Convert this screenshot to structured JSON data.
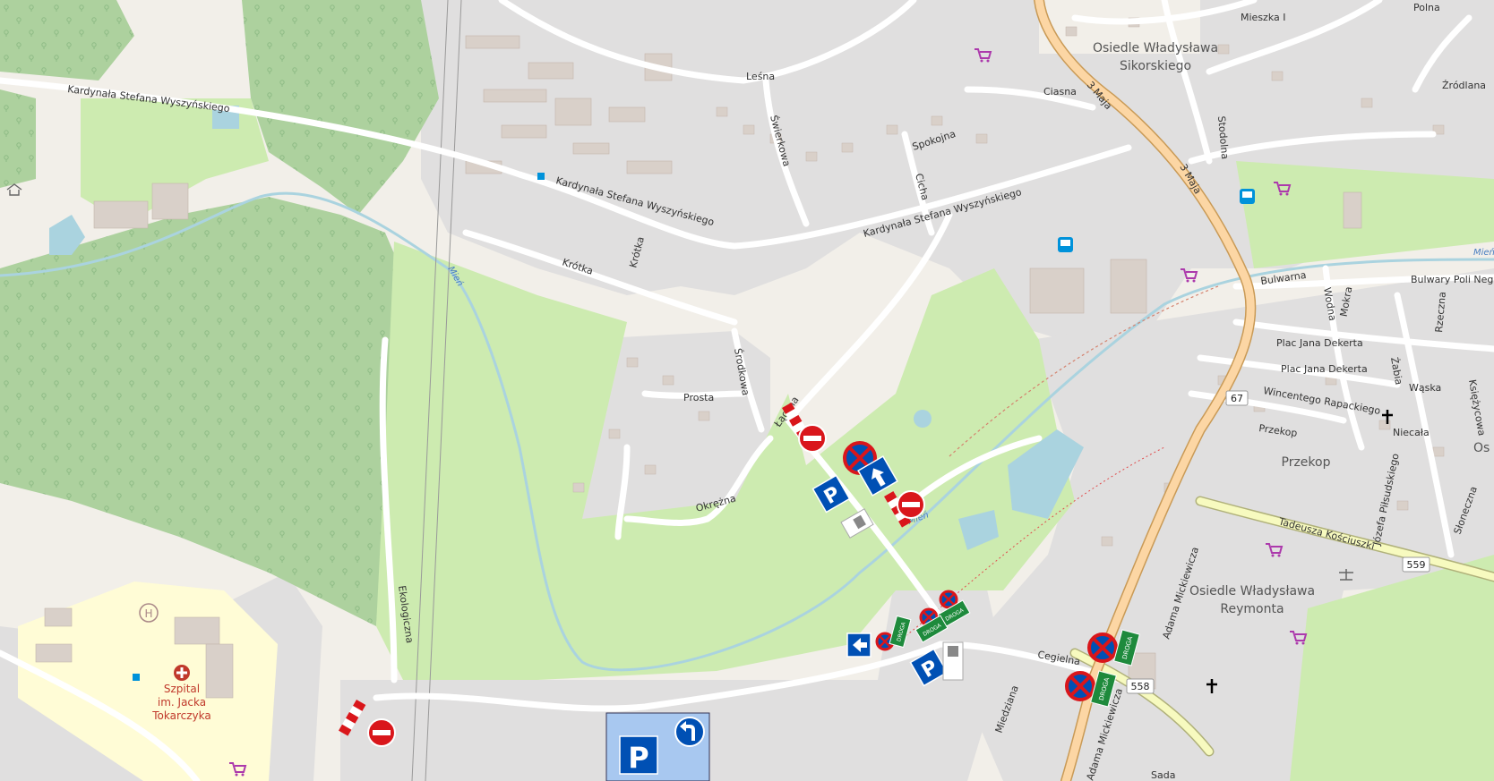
{
  "map": {
    "streets": {
      "wyszynskiego_west": "Kardynała Stefana Wyszyńskiego",
      "wyszynskiego_mid": "Kardynała Stefana Wyszyńskiego",
      "wyszynskiego_east": "Kardynała Stefana Wyszyńskiego",
      "lesna": "Leśna",
      "krotka_a": "Krótka",
      "krotka_b": "Krótka",
      "swierkowa": "Świerkowa",
      "spokojna": "Spokojna",
      "cicha": "Cicha",
      "ciasna": "Ciasna",
      "srodkowa": "Środkowa",
      "prosta": "Prosta",
      "laczna": "Łączna",
      "okrezna": "Okrężna",
      "ekologiczna": "Ekologiczna",
      "cegielna": "Cegielna",
      "miedziana": "Miedziana",
      "trzeciego_maja_a": "3 Maja",
      "trzeciego_maja_b": "3 Maja",
      "mickiewicza_a": "Adama Mickiewicza",
      "mickiewicza_b": "Adama Mickiewicza",
      "mieszka": "Mieszka I",
      "stodolna": "Stodolna",
      "polna": "Polna",
      "zrodlana": "Źródlana",
      "bulwarna": "Bulwarna",
      "bulwary": "Bulwary Poli Negr",
      "wodna": "Wodna",
      "mokra": "Mokra",
      "rzeczna": "Rzeczna",
      "dekerta_a": "Plac Jana Dekerta",
      "dekerta_b": "Plac Jana Dekerta",
      "rapackiego": "Wincentego Rapackiego",
      "zabia": "Żabia",
      "waska": "Wąska",
      "przekop_street": "Przekop",
      "pilsudskiego": "Józefa Piłsudskiego",
      "niecala": "Niecała",
      "ksiezycowa": "Księżycowa",
      "kosciuszki": "Tadeusza Kościuszki",
      "sloneczna": "Słoneczna",
      "sada": "Sada"
    },
    "places": {
      "sikorskiego_line1": "Osiedle Władysława",
      "sikorskiego_line2": "Sikorskiego",
      "reymonta_line1": "Osiedle Władysława",
      "reymonta_line2": "Reymonta",
      "przekop": "Przekop",
      "hospital_line1": "Szpital",
      "hospital_line2": "im. Jacka",
      "hospital_line3": "Tokarczyka",
      "river_a": "Mień",
      "river_b": "Mień",
      "river_c": "Mień",
      "edge_os": "Os"
    },
    "road_shields": {
      "r67": "67",
      "r558": "558",
      "r559": "559"
    },
    "sign_text": {
      "droga_1": "DROGA",
      "droga_2": "DROGA",
      "droga_3": "DROGA",
      "droga_4": "DROGA",
      "droga_5": "DROGA"
    },
    "icons": [
      "shop-cart-icon",
      "bus-stop-icon",
      "church-icon",
      "hospital-icon",
      "court-icon",
      "parking-sign-icon",
      "no-entry-sign-icon",
      "no-stopping-sign-icon",
      "one-way-sign-icon",
      "roadblock-icon"
    ],
    "colors": {
      "forest": "#add19e",
      "grass": "#cdebb0",
      "residential": "#e0dfdf",
      "road_primary": "#fcd6a4",
      "road_secondary": "#f7fabf",
      "water": "#aad3df",
      "sign_blue": "#0050b4",
      "sign_red": "#d9161b"
    }
  }
}
